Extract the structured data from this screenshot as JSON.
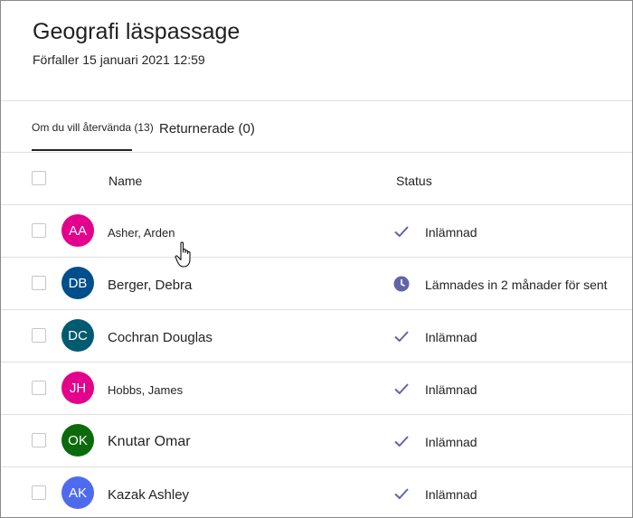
{
  "assignment": {
    "title": "Geografi läspassage",
    "due": "Förfaller 15 januari 2021 12:59"
  },
  "tabs": [
    {
      "label": "Om du vill återvända (13)",
      "active": true
    },
    {
      "label": "Returnerade (0)",
      "active": false
    }
  ],
  "table": {
    "headers": {
      "name": "Name",
      "status": "Status"
    },
    "rows": [
      {
        "initials": "AA",
        "name": "Asher, Arden",
        "avatar_color": "#e3008c",
        "status": "Inlämnad",
        "status_icon": "check-icon"
      },
      {
        "initials": "DB",
        "name": "Berger, Debra",
        "avatar_color": "#004e8c",
        "status": "Lämnades in 2 månader för sent",
        "status_icon": "clock-icon"
      },
      {
        "initials": "DC",
        "name": "Cochran Douglas",
        "avatar_color": "#005b70",
        "status": "Inlämnad",
        "status_icon": "check-icon"
      },
      {
        "initials": "JH",
        "name": "Hobbs, James",
        "avatar_color": "#e3008c",
        "status": "Inlämnad",
        "status_icon": "check-icon"
      },
      {
        "initials": "OK",
        "name": "Knutar Omar",
        "avatar_color": "#0b6a0b",
        "status": "Inlämnad",
        "status_icon": "check-icon"
      },
      {
        "initials": "AK",
        "name": "Kazak Ashley",
        "avatar_color": "#4f6bed",
        "status": "Inlämnad",
        "status_icon": "check-icon"
      }
    ]
  },
  "colors": {
    "accent": "#6264a7",
    "divider": "#e1dfdd",
    "text": "#252423"
  }
}
